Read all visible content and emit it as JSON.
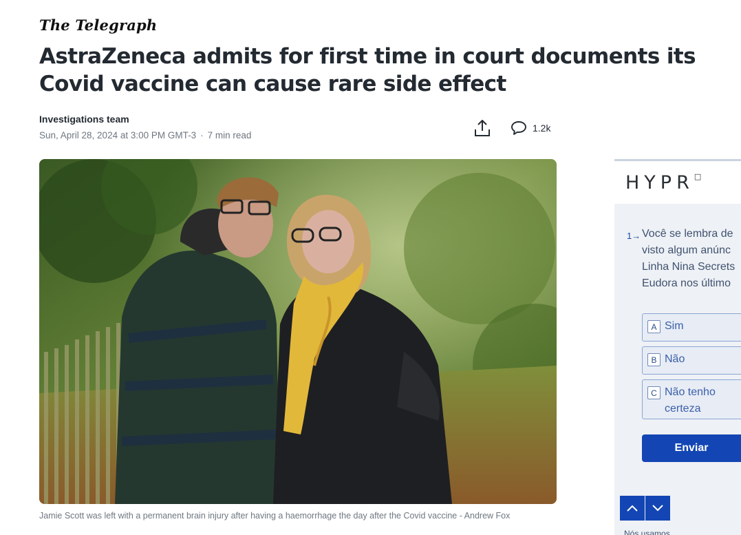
{
  "site": {
    "logo": "The Telegraph"
  },
  "article": {
    "headline": "AstraZeneca admits for first time in court documents its Covid vaccine can cause rare side effect",
    "author": "Investigations team",
    "date": "Sun, April 28, 2024 at 3:00 PM GMT-3",
    "separator": "·",
    "read_time": "7 min read",
    "comments_count": "1.2k",
    "caption": "Jamie Scott was left with a permanent brain injury after having a haemorrhage the day after the Covid vaccine - Andrew Fox"
  },
  "icons": {
    "share": "share-icon",
    "comments": "comment-icon",
    "up": "chevron-up-icon",
    "down": "chevron-down-icon"
  },
  "ad": {
    "brand": "HYPR",
    "question_number": "1→",
    "question": "Você se lembra de\nvisto algum anúnc\nLinha Nina Secrets\nEudora nos último",
    "options": [
      {
        "key": "A",
        "label": "Sim"
      },
      {
        "key": "B",
        "label": "Não"
      },
      {
        "key": "C",
        "label": "Não tenho certeza"
      }
    ],
    "submit": "Enviar",
    "footer": "Nós usamos"
  },
  "colors": {
    "accent": "#1346b4",
    "text": "#232a31",
    "muted": "#6e7780",
    "scarf": "#e2b83a"
  }
}
